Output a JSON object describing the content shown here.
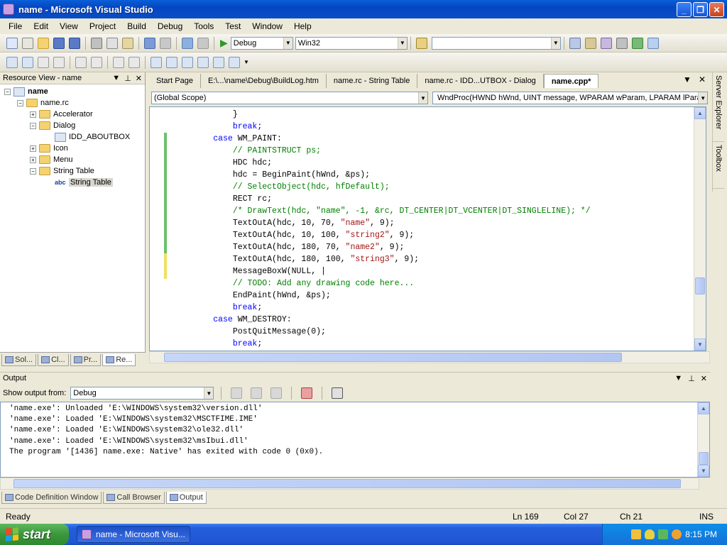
{
  "window": {
    "title": "name - Microsoft Visual Studio",
    "min": "_",
    "max": "❐",
    "close": "✕"
  },
  "menu": [
    "File",
    "Edit",
    "View",
    "Project",
    "Build",
    "Debug",
    "Tools",
    "Test",
    "Window",
    "Help"
  ],
  "toolbar": {
    "config": "Debug",
    "platform": "Win32",
    "find": ""
  },
  "resource_view": {
    "title": "Resource View - name",
    "tree": {
      "root": "name",
      "rc": "name.rc",
      "accelerator": "Accelerator",
      "dialog": "Dialog",
      "dialog_item": "IDD_ABOUTBOX",
      "icon": "Icon",
      "menu": "Menu",
      "string_table": "String Table",
      "string_table_item": "String Table",
      "abc": "abc"
    },
    "tabs": [
      "Sol...",
      "Cl...",
      "Pr...",
      "Re..."
    ]
  },
  "doc_tabs": [
    "Start Page",
    "E:\\...\\name\\Debug\\BuildLog.htm",
    "name.rc - String Table",
    "name.rc - IDD...UTBOX - Dialog",
    "name.cpp*"
  ],
  "scope": {
    "left": "(Global Scope)",
    "right": "WndProc(HWND hWnd, UINT message, WPARAM wParam, LPARAM lPara"
  },
  "side_tabs": [
    "Server Explorer",
    "Toolbox"
  ],
  "output": {
    "title": "Output",
    "show_label": "Show output from:",
    "show_value": "Debug",
    "lines": [
      "'name.exe': Unloaded 'E:\\WINDOWS\\system32\\version.dll'",
      "'name.exe': Loaded 'E:\\WINDOWS\\system32\\MSCTFIME.IME'",
      "'name.exe': Loaded 'E:\\WINDOWS\\system32\\ole32.dll'",
      "'name.exe': Loaded 'E:\\WINDOWS\\system32\\msIbui.dll'",
      "The program '[1436] name.exe: Native' has exited with code 0 (0x0)."
    ],
    "tabs": [
      "Code Definition Window",
      "Call Browser",
      "Output"
    ]
  },
  "status": {
    "ready": "Ready",
    "ln": "Ln 169",
    "col": "Col 27",
    "ch": "Ch 21",
    "ins": "INS"
  },
  "taskbar": {
    "start": "start",
    "item": "name - Microsoft Visu...",
    "clock": "8:15 PM"
  }
}
